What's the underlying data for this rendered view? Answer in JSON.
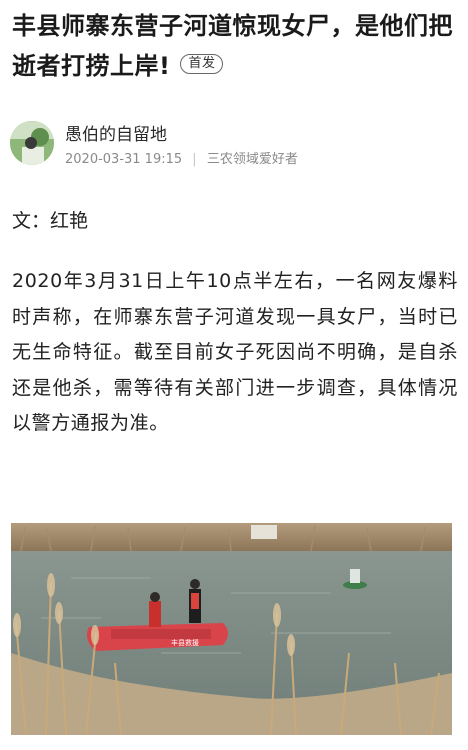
{
  "article": {
    "title": "丰县师寨东营子河道惊现女尸，是他们把逝者打捞上岸!",
    "badge": "首发",
    "author": {
      "name": "愚伯的自留地",
      "datetime": "2020-03-31 19:15",
      "tag": "三农领域爱好者"
    },
    "byline": "文：红艳",
    "body": "2020年3月31日上午10点半左右，一名网友爆料时声称，在师寨东营子河道发现一具女尸，当时已无生命特征。截至目前女子死因尚不明确，是自杀还是他杀，需等待有关部门进一步调查，具体情况以警方通报为准。"
  },
  "photo": {
    "boat_label": "丰县救援"
  }
}
